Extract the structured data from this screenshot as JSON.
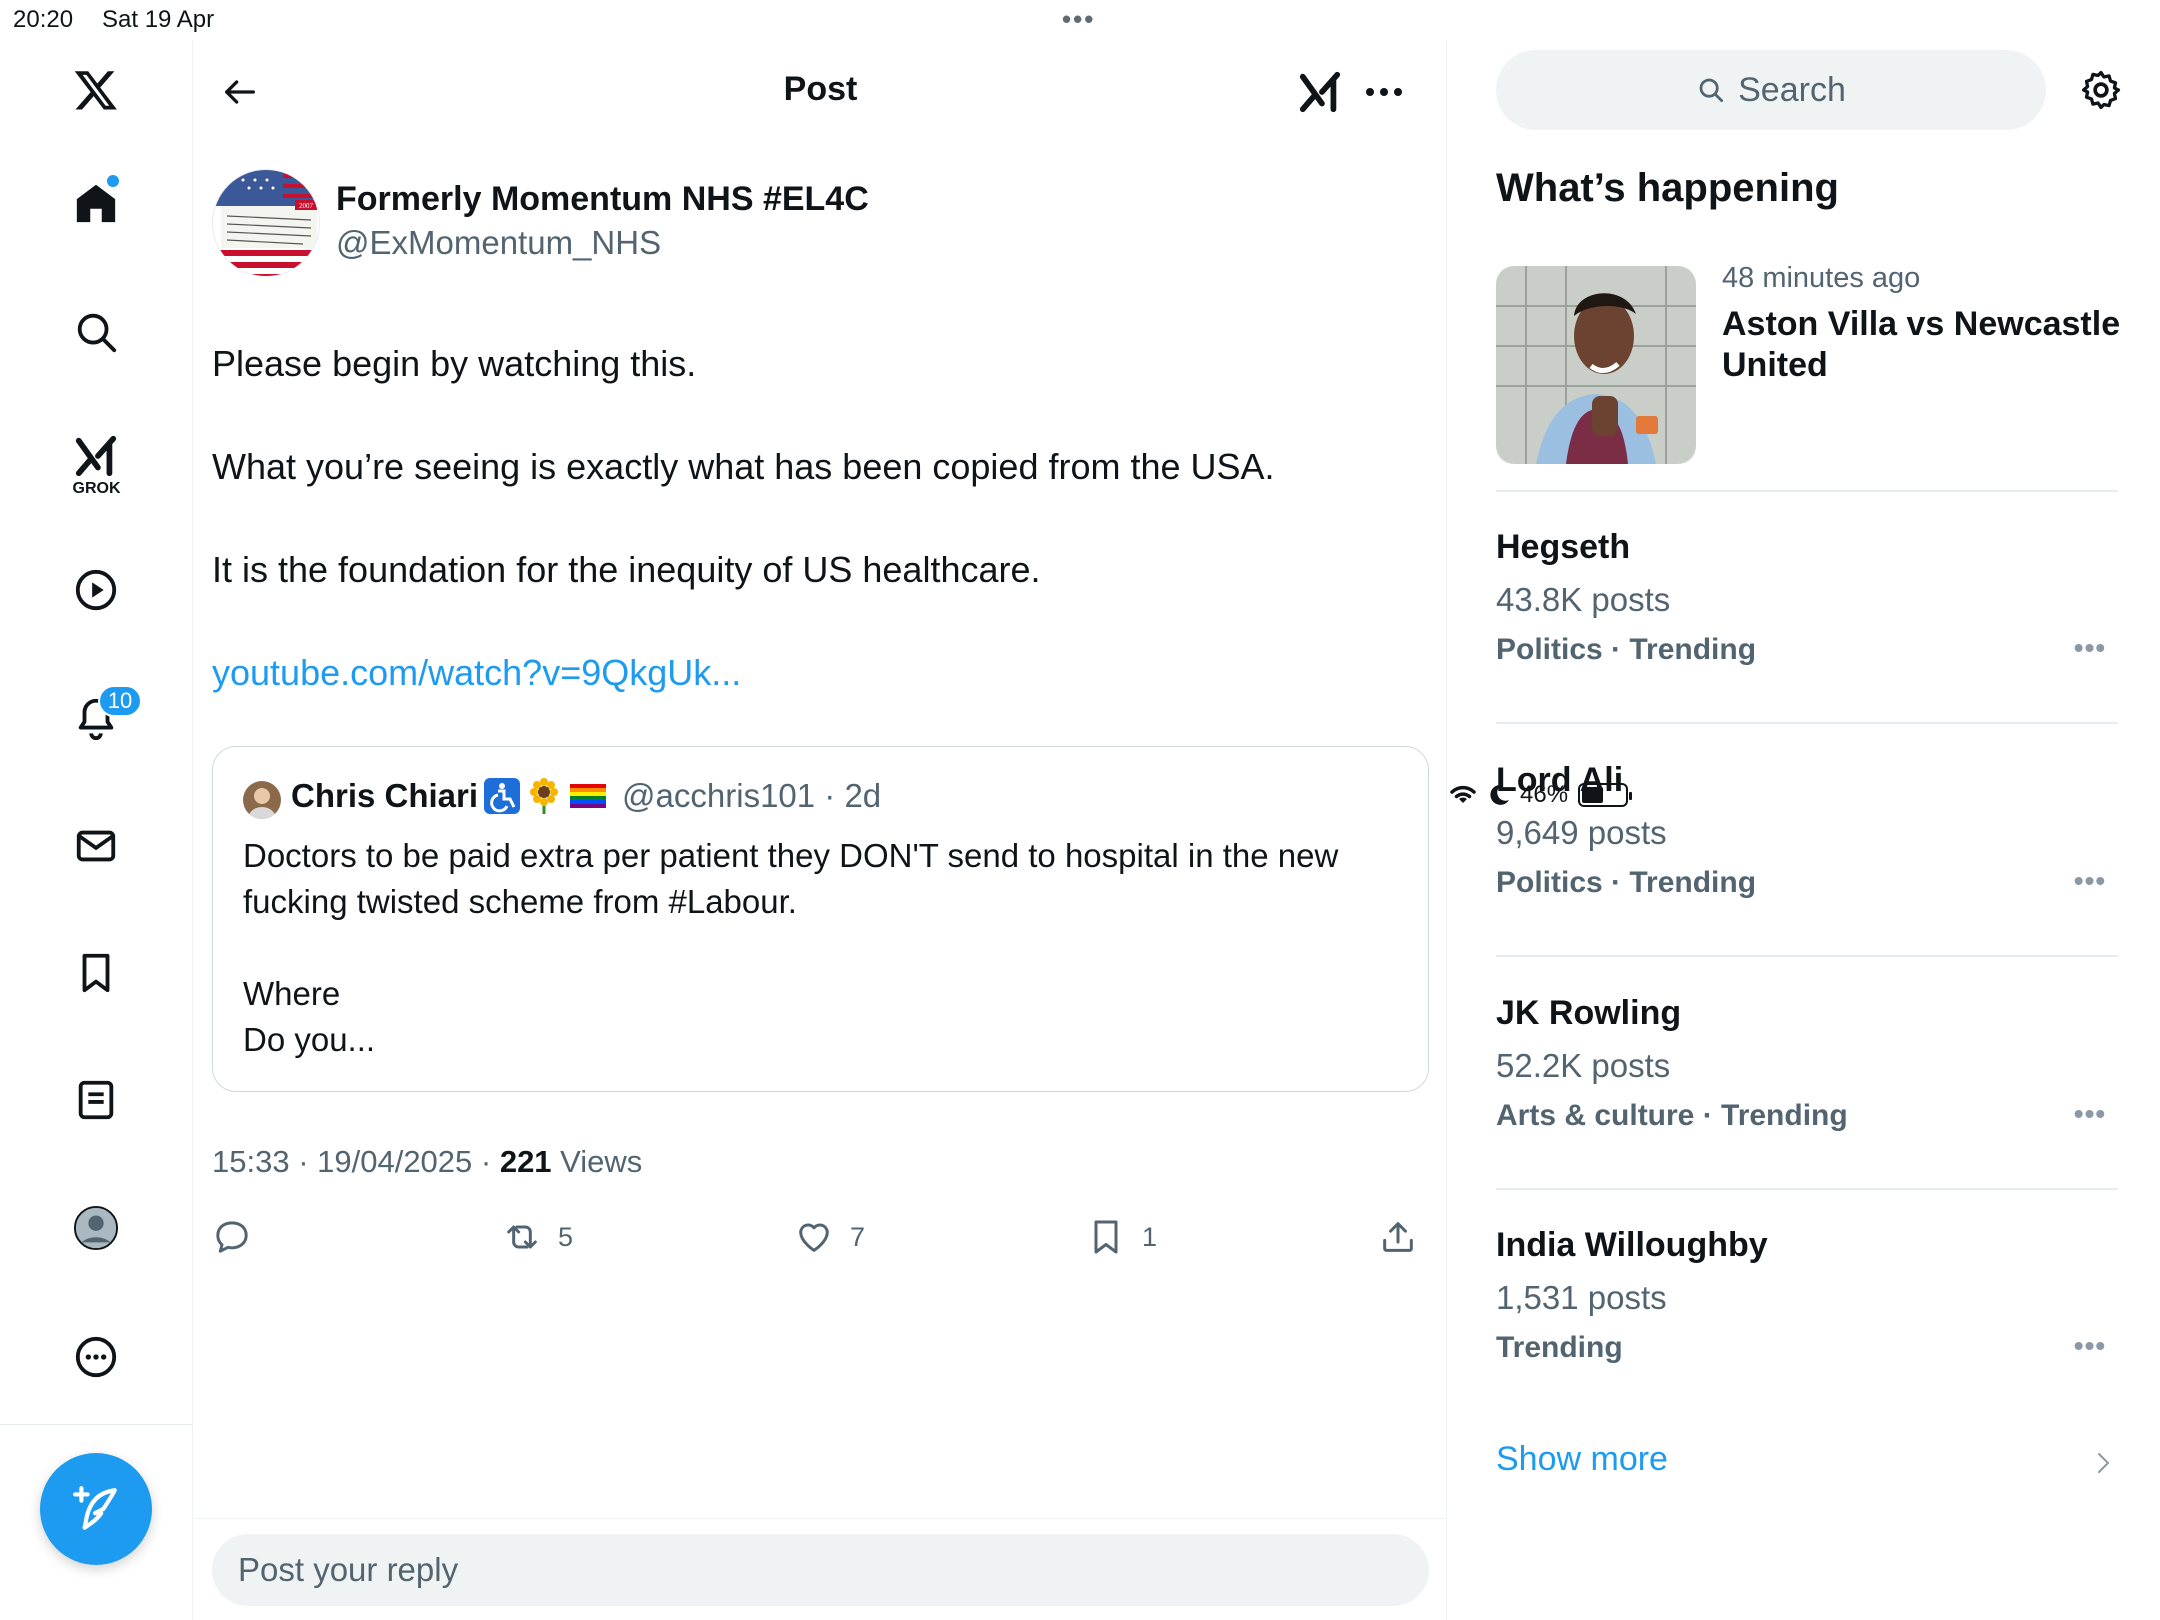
{
  "status_bar": {
    "time": "20:20",
    "date": "Sat 19 Apr",
    "battery": "46%",
    "battery_level": 0.46
  },
  "nav": {
    "logo": "x-logo-icon",
    "items": [
      "home-icon",
      "search-icon",
      "grok-icon",
      "video-icon",
      "notifications-icon",
      "messages-icon",
      "bookmarks-icon",
      "lists-icon",
      "profile-icon",
      "more-icon"
    ],
    "grok_label": "GROK",
    "notifications_badge": "10",
    "compose": "compose-post-icon"
  },
  "header": {
    "title": "Post"
  },
  "post": {
    "author_name": "Formerly Momentum NHS #EL4C",
    "author_handle": "@ExMomentum_NHS",
    "avatar_text": "U.S. And U.K. Sign Agreements To Collaborate On Health Care Quality And Fighting Bioterrorism",
    "avatar_year": "2007",
    "text_1": "Please begin by watching this.",
    "text_2": "What you’re seeing is exactly what has been copied from the USA.",
    "text_3": "It is the foundation for the inequity of US healthcare.",
    "link": "youtube.com/watch?v=9QkgUk...",
    "timestamp": "15:33 · 19/04/2025 · ",
    "views_count": "221",
    "views_label": " Views"
  },
  "quote": {
    "name": "Chris Chiari",
    "handle": "@acchris101 · 2d",
    "text_1": "Doctors to be paid extra per patient they DON'T send to hospital in the new fucking twisted scheme from #Labour.",
    "text_2a": "Where",
    "text_2b": "Do you..."
  },
  "actions": {
    "reply_count": "",
    "repost_count": "5",
    "like_count": "7",
    "bookmark_count": "1"
  },
  "reply": {
    "placeholder": "Post your reply"
  },
  "sidebar": {
    "search_placeholder": "Search",
    "section_title": "What’s happening",
    "event": {
      "time": "48 minutes ago",
      "title": "Aston Villa vs Newcastle United"
    },
    "trends": [
      {
        "name": "Hegseth",
        "posts": "43.8K posts",
        "category": "Politics · Trending"
      },
      {
        "name": "Lord Ali",
        "posts": "9,649 posts",
        "category": "Politics · Trending"
      },
      {
        "name": "JK Rowling",
        "posts": "52.2K posts",
        "category": "Arts & culture · Trending"
      },
      {
        "name": "India Willoughby",
        "posts": "1,531 posts",
        "category": "Trending"
      }
    ],
    "show_more": "Show more"
  }
}
